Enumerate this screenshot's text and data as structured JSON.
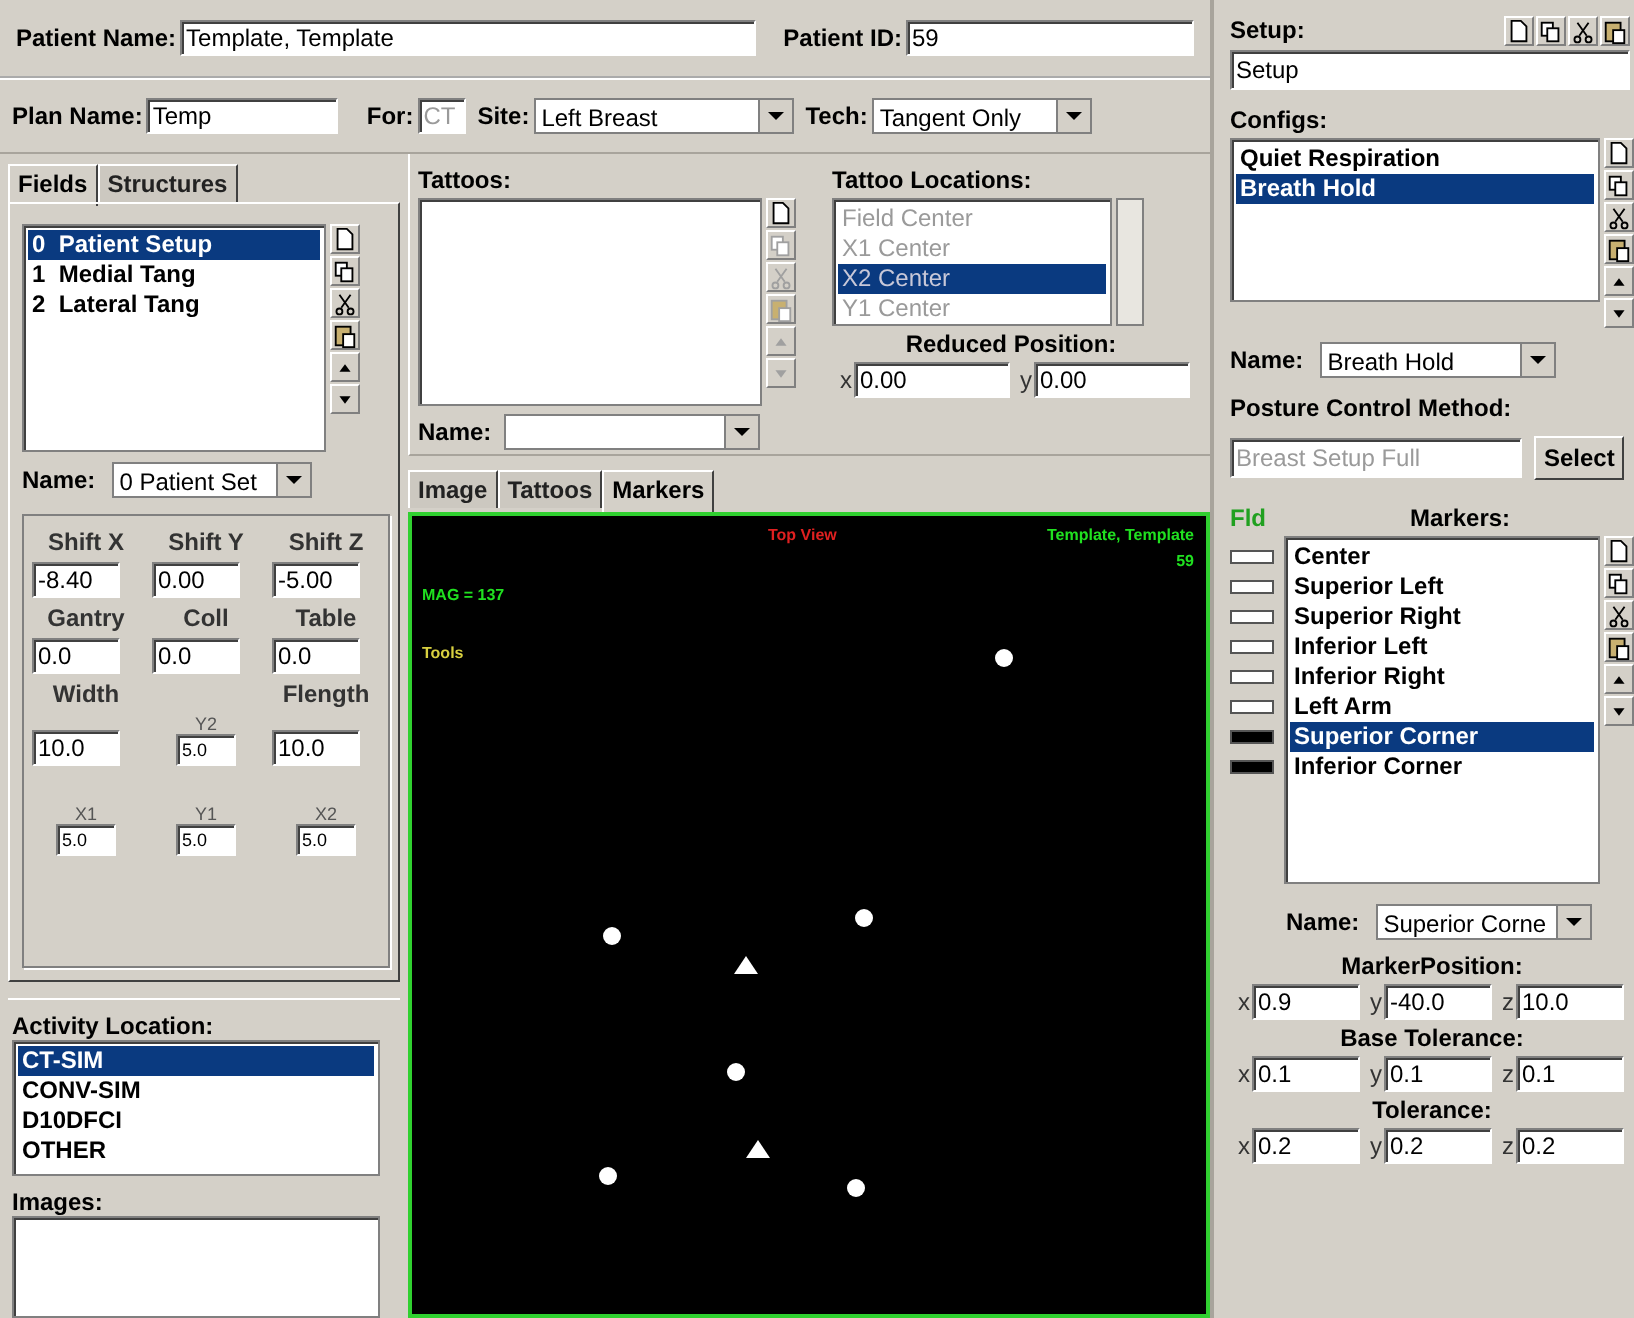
{
  "patient": {
    "name_label": "Patient Name:",
    "name": "Template, Template",
    "id_label": "Patient ID:",
    "id": "59"
  },
  "plan": {
    "name_label": "Plan Name:",
    "name": "Temp",
    "for_label": "For:",
    "for": "CT",
    "site_label": "Site:",
    "site": "Left Breast",
    "tech_label": "Tech:",
    "tech": "Tangent Only"
  },
  "left_tabs": [
    {
      "label": "Fields",
      "selected": true
    },
    {
      "label": "Structures",
      "selected": false
    }
  ],
  "fields": [
    {
      "number": "0",
      "name": "Patient Setup",
      "selected": true
    },
    {
      "number": "1",
      "name": "Medial Tang",
      "selected": false
    },
    {
      "number": "2",
      "name": "Lateral Tang",
      "selected": false
    }
  ],
  "field_name": {
    "label": "Name:",
    "value": "0  Patient Set"
  },
  "shifts": [
    {
      "label": "Shift X",
      "value": "-8.40"
    },
    {
      "label": "Shift Y",
      "value": "0.00"
    },
    {
      "label": "Shift Z",
      "value": "-5.00"
    }
  ],
  "angles": [
    {
      "label": "Gantry",
      "value": "0.0"
    },
    {
      "label": "Coll",
      "value": "0.0"
    },
    {
      "label": "Table",
      "value": "0.0"
    }
  ],
  "width": {
    "label": "Width",
    "value": "10.0"
  },
  "flength": {
    "label": "Flength",
    "value": "10.0"
  },
  "jaws": {
    "y2": {
      "label": "Y2",
      "value": "5.0"
    },
    "x1": {
      "label": "X1",
      "value": "5.0"
    },
    "x2": {
      "label": "X2",
      "value": "5.0"
    },
    "y1": {
      "label": "Y1",
      "value": "5.0"
    }
  },
  "activity_location": {
    "label": "Activity Location:",
    "items": [
      {
        "label": "CT-SIM",
        "selected": true
      },
      {
        "label": "CONV-SIM",
        "selected": false
      },
      {
        "label": "D10DFCI",
        "selected": false
      },
      {
        "label": "OTHER",
        "selected": false
      }
    ]
  },
  "images": {
    "label": "Images:"
  },
  "tattoos": {
    "label": "Tattoos:",
    "name_label": "Name:"
  },
  "tattoo_locations": {
    "label": "Tattoo Locations:",
    "disabled": true,
    "items": [
      {
        "label": "Field Center",
        "selected": false
      },
      {
        "label": "X1 Center",
        "selected": false
      },
      {
        "label": "X2 Center",
        "selected": true
      },
      {
        "label": "Y1 Center",
        "selected": false
      }
    ]
  },
  "reduced_position": {
    "label": "Reduced Position:",
    "axes": [
      {
        "axis": "x",
        "value": "0.00"
      },
      {
        "axis": "y",
        "value": "0.00"
      }
    ]
  },
  "view_tabs": [
    {
      "label": "Image",
      "selected": false
    },
    {
      "label": "Tattoos",
      "selected": false
    },
    {
      "label": "Markers",
      "selected": true
    }
  ],
  "view": {
    "title": "Top View",
    "patient": "Template, Template",
    "id": "59",
    "mag": "MAG = 137",
    "tools": "Tools"
  },
  "setup": {
    "label": "Setup:",
    "value": "Setup"
  },
  "configs": {
    "label": "Configs:",
    "items": [
      {
        "label": "Quiet Respiration",
        "selected": false
      },
      {
        "label": "Breath Hold",
        "selected": true
      }
    ],
    "name_label": "Name:",
    "name": "Breath Hold"
  },
  "posture": {
    "label": "Posture Control Method:",
    "value": "Breast Setup Full",
    "disabled": true,
    "button": "Select"
  },
  "markers": {
    "fld_label": "Fld",
    "label": "Markers:",
    "items": [
      {
        "name": "Center",
        "color": "#ffffff",
        "selected": false
      },
      {
        "name": "Superior Left",
        "color": "#ffffff",
        "selected": false
      },
      {
        "name": "Superior Right",
        "color": "#ffffff",
        "selected": false
      },
      {
        "name": "Inferior Left",
        "color": "#ffffff",
        "selected": false
      },
      {
        "name": "Inferior Right",
        "color": "#ffffff",
        "selected": false
      },
      {
        "name": "Left Arm",
        "color": "#ffffff",
        "selected": false
      },
      {
        "name": "Superior Corner",
        "color": "#000000",
        "selected": true
      },
      {
        "name": "Inferior Corner",
        "color": "#000000",
        "selected": false
      }
    ],
    "name_label": "Name:",
    "name": "Superior Corne"
  },
  "marker_position": {
    "label": "MarkerPosition:",
    "axes": [
      {
        "axis": "x",
        "value": "0.9"
      },
      {
        "axis": "y",
        "value": "-40.0"
      },
      {
        "axis": "z",
        "value": "10.0"
      }
    ]
  },
  "base_tolerance": {
    "label": "Base Tolerance:",
    "axes": [
      {
        "axis": "x",
        "value": "0.1"
      },
      {
        "axis": "y",
        "value": "0.1"
      },
      {
        "axis": "z",
        "value": "0.1"
      }
    ]
  },
  "tolerance": {
    "label": "Tolerance:",
    "axes": [
      {
        "axis": "x",
        "value": "0.2"
      },
      {
        "axis": "y",
        "value": "0.2"
      },
      {
        "axis": "z",
        "value": "0.2"
      }
    ]
  }
}
